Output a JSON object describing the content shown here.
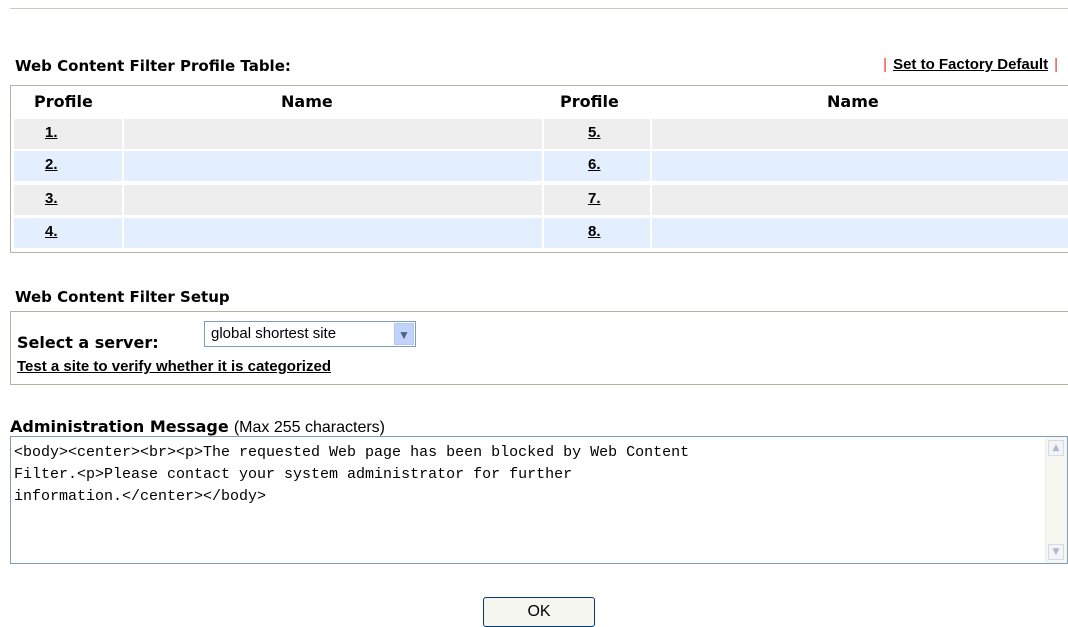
{
  "profile_table": {
    "title": "Web Content Filter Profile Table:",
    "factory_default_link": "Set to Factory Default",
    "separator": "|",
    "headers": {
      "profile1": "Profile",
      "name1": "Name",
      "profile2": "Profile",
      "name2": "Name"
    },
    "rows": [
      {
        "left": "1.",
        "left_name": "",
        "right": "5.",
        "right_name": ""
      },
      {
        "left": "2.",
        "left_name": "",
        "right": "6.",
        "right_name": ""
      },
      {
        "left": "3.",
        "left_name": "",
        "right": "7.",
        "right_name": ""
      },
      {
        "left": "4.",
        "left_name": "",
        "right": "8.",
        "right_name": ""
      }
    ]
  },
  "setup": {
    "title": "Web Content Filter Setup",
    "select_label": "Select a server:",
    "server_value": "global shortest site",
    "test_link": "Test a site to verify whether it is categorized"
  },
  "admin": {
    "title": "Administration Message",
    "hint": "(Max 255 characters)",
    "message": "<body><center><br><p>The requested Web page has been blocked by Web Content\nFilter.<p>Please contact your system administrator for further\ninformation.</center></body>"
  },
  "ok_button": "OK",
  "icons": {
    "dropdown": "chevron-down-icon",
    "scroll_up": "scroll-up-icon",
    "scroll_down": "scroll-down-icon"
  },
  "colors": {
    "row_gray": "#eeeeee",
    "row_blue": "#e3efff",
    "separator_red": "#e8322a"
  }
}
